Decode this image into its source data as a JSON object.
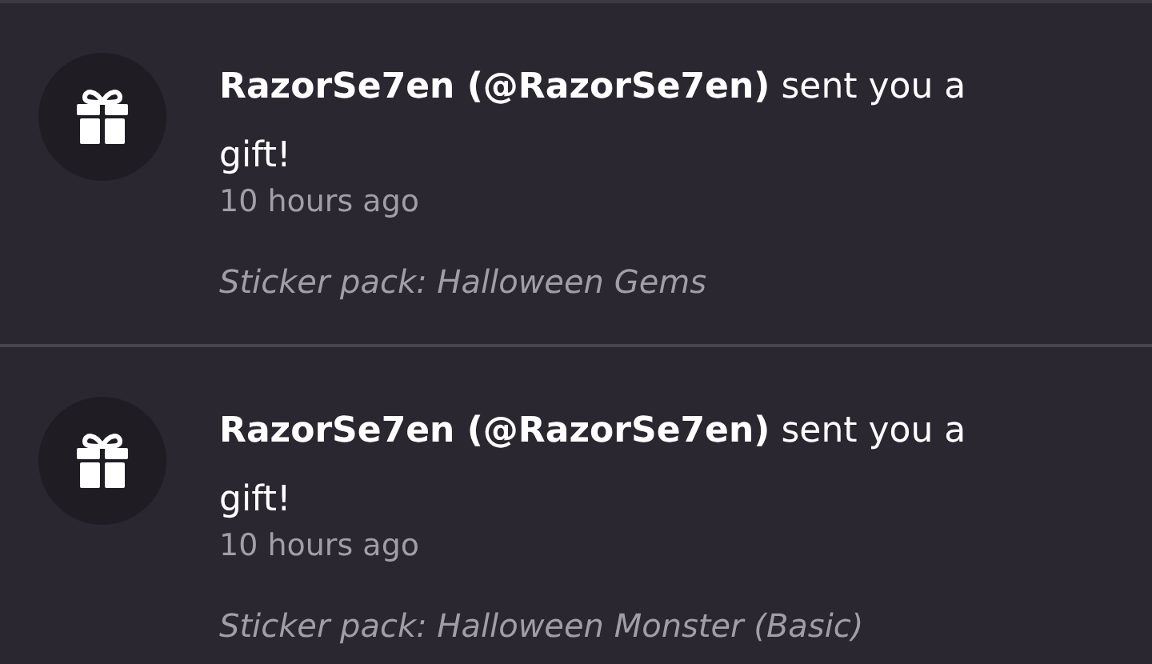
{
  "notifications": [
    {
      "message": "**RazorSe7en (@RazorSe7en)** sent you a gift!",
      "time": "10 hours ago",
      "detail": "Sticker pack: Halloween Gems"
    },
    {
      "message": "**RazorSe7en (@RazorSe7en)** sent you a gift!",
      "time": "10 hours ago",
      "detail": "Sticker pack: Halloween Monster (Basic)"
    }
  ]
}
